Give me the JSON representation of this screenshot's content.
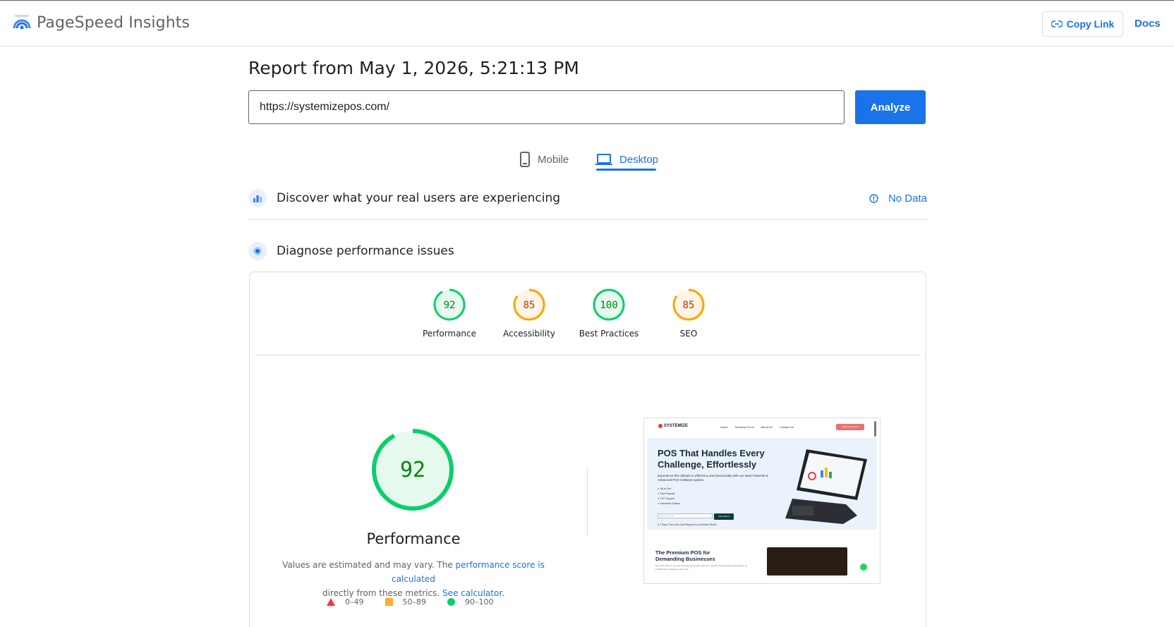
{
  "header": {
    "brand": "PageSpeed Insights",
    "copy_link": "Copy Link",
    "docs": "Docs"
  },
  "report": {
    "title": "Report from May 1, 2026, 5:21:13 PM",
    "url_value": "https://systemizepos.com/",
    "analyze_label": "Analyze"
  },
  "tabs": [
    {
      "label": "Mobile",
      "icon": "phone-icon",
      "selected": false
    },
    {
      "label": "Desktop",
      "icon": "laptop-icon",
      "selected": true
    }
  ],
  "crux": {
    "title": "Discover what your real users are experiencing",
    "status": "No Data",
    "icon": "crux-chart-icon"
  },
  "diagnose": {
    "title": "Diagnose performance issues",
    "icon": "lighthouse-icon"
  },
  "scores": [
    {
      "label": "Performance",
      "value": 92,
      "rating": "good"
    },
    {
      "label": "Accessibility",
      "value": 85,
      "rating": "average"
    },
    {
      "label": "Best Practices",
      "value": 100,
      "rating": "good"
    },
    {
      "label": "SEO",
      "value": 85,
      "rating": "average"
    }
  ],
  "performance": {
    "score": "92",
    "label": "Performance",
    "note_prefix": "Values are estimated and may vary. The ",
    "note_link1": "performance score is calculated",
    "note_middle": "directly from these metrics.",
    "note_link2": "See calculator."
  },
  "legend": [
    {
      "range": "0–49",
      "shape": "triangle",
      "color": "#ff3333"
    },
    {
      "range": "50–89",
      "shape": "square",
      "color": "#ffaa33"
    },
    {
      "range": "90–100",
      "shape": "circle",
      "color": "#0cce6b"
    }
  ],
  "colors": {
    "accent": "#1a73e8",
    "good": "#0cce6b",
    "good_text": "#008800",
    "average": "#ffa400",
    "average_text": "#c33300"
  },
  "thumbnail": {
    "logo": "SYSTEMIZE",
    "nav": [
      "Home",
      "Solutions For ▾",
      "About Us",
      "Contact Us"
    ],
    "cta": "Request A Demo",
    "hero_title": "POS That Handles Every Challenge, Effortlessly",
    "hero_text": "Experience the ultimate in efficiency and functionality with our Most Powerful & Advanced POS Software system.",
    "features": [
      "✔ All-in-One",
      "✔ Fast Payouts",
      "✔ 24/7 Support",
      "✔ Hardware Options"
    ],
    "email_placeholder": "enter your mail",
    "go_label": "Get Started",
    "badges": "● 7 Days Trial   ● No Card Required   ● Unlimited Stores",
    "section2_title": "The Premium POS for Demanding Businesses",
    "section2_text": "Systemize POS is the only-trusted point-of-sale solution in demand by businesses everywhere, as it effortlessly manages in-store and"
  }
}
